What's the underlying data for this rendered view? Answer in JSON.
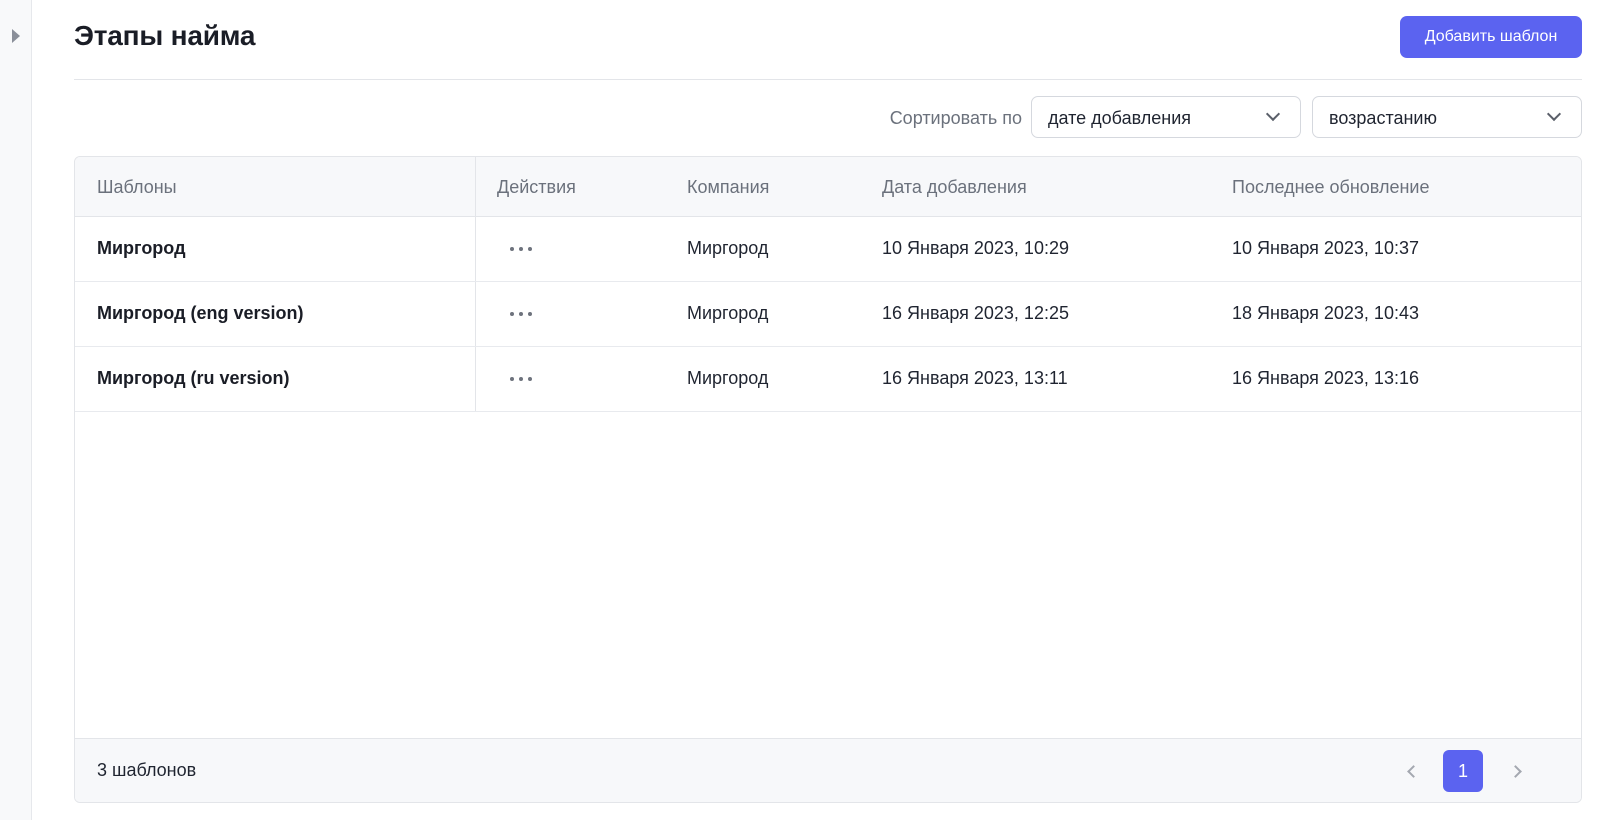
{
  "sidebar": {
    "toggle_icon": "chevron-right-icon"
  },
  "header": {
    "title": "Этапы найма",
    "add_button_label": "Добавить шаблон",
    "accent_color": "#5b63f0"
  },
  "sort": {
    "label": "Сортировать по",
    "field_value": "дате добавления",
    "order_value": "возрастанию"
  },
  "table": {
    "columns": [
      "Шаблоны",
      "Действия",
      "Компания",
      "Дата добавления",
      "Последнее обновление"
    ],
    "rows": [
      {
        "name": "Миргород",
        "actions_icon": "more-horizontal-icon",
        "company": "Миргород",
        "added": "10 Января 2023, 10:29",
        "updated": "10 Января 2023, 10:37"
      },
      {
        "name": "Миргород (eng version)",
        "actions_icon": "more-horizontal-icon",
        "company": "Миргород",
        "added": "16 Января 2023, 12:25",
        "updated": "18 Января 2023, 10:43"
      },
      {
        "name": "Миргород (ru version)",
        "actions_icon": "more-horizontal-icon",
        "company": "Миргород",
        "added": "16 Января 2023, 13:11",
        "updated": "16 Января 2023, 13:16"
      }
    ]
  },
  "footer": {
    "count_text": "3 шаблонов",
    "current_page": "1"
  }
}
